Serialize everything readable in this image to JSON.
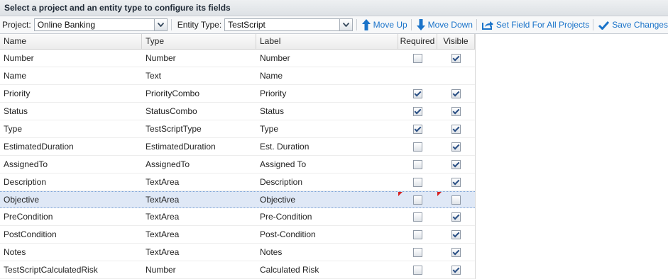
{
  "title": "Select a project and an entity type to configure its fields",
  "toolbar": {
    "project_label": "Project:",
    "project_value": "Online Banking",
    "entity_label": "Entity Type:",
    "entity_value": "TestScript",
    "move_up": "Move Up",
    "move_down": "Move Down",
    "set_all": "Set Field For All Projects",
    "save": "Save Changes",
    "accent": "#1a73c9"
  },
  "columns": {
    "name": "Name",
    "type": "Type",
    "label": "Label",
    "required": "Required",
    "visible": "Visible"
  },
  "rows": [
    {
      "name": "Number",
      "type": "Number",
      "label": "Number",
      "required": false,
      "visible": true
    },
    {
      "name": "Name",
      "type": "Text",
      "label": "Name",
      "required": null,
      "visible": null
    },
    {
      "name": "Priority",
      "type": "PriorityCombo",
      "label": "Priority",
      "required": true,
      "visible": true
    },
    {
      "name": "Status",
      "type": "StatusCombo",
      "label": "Status",
      "required": true,
      "visible": true
    },
    {
      "name": "Type",
      "type": "TestScriptType",
      "label": "Type",
      "required": true,
      "visible": true
    },
    {
      "name": "EstimatedDuration",
      "type": "EstimatedDuration",
      "label": "Est. Duration",
      "required": false,
      "visible": true
    },
    {
      "name": "AssignedTo",
      "type": "AssignedTo",
      "label": "Assigned To",
      "required": false,
      "visible": true
    },
    {
      "name": "Description",
      "type": "TextArea",
      "label": "Description",
      "required": false,
      "visible": true
    },
    {
      "name": "Objective",
      "type": "TextArea",
      "label": "Objective",
      "required": false,
      "visible": false,
      "selected": true,
      "dirty": true
    },
    {
      "name": "PreCondition",
      "type": "TextArea",
      "label": "Pre-Condition",
      "required": false,
      "visible": true
    },
    {
      "name": "PostCondition",
      "type": "TextArea",
      "label": "Post-Condition",
      "required": false,
      "visible": true
    },
    {
      "name": "Notes",
      "type": "TextArea",
      "label": "Notes",
      "required": false,
      "visible": true
    },
    {
      "name": "TestScriptCalculatedRisk",
      "type": "Number",
      "label": "Calculated Risk",
      "required": false,
      "visible": true
    }
  ]
}
